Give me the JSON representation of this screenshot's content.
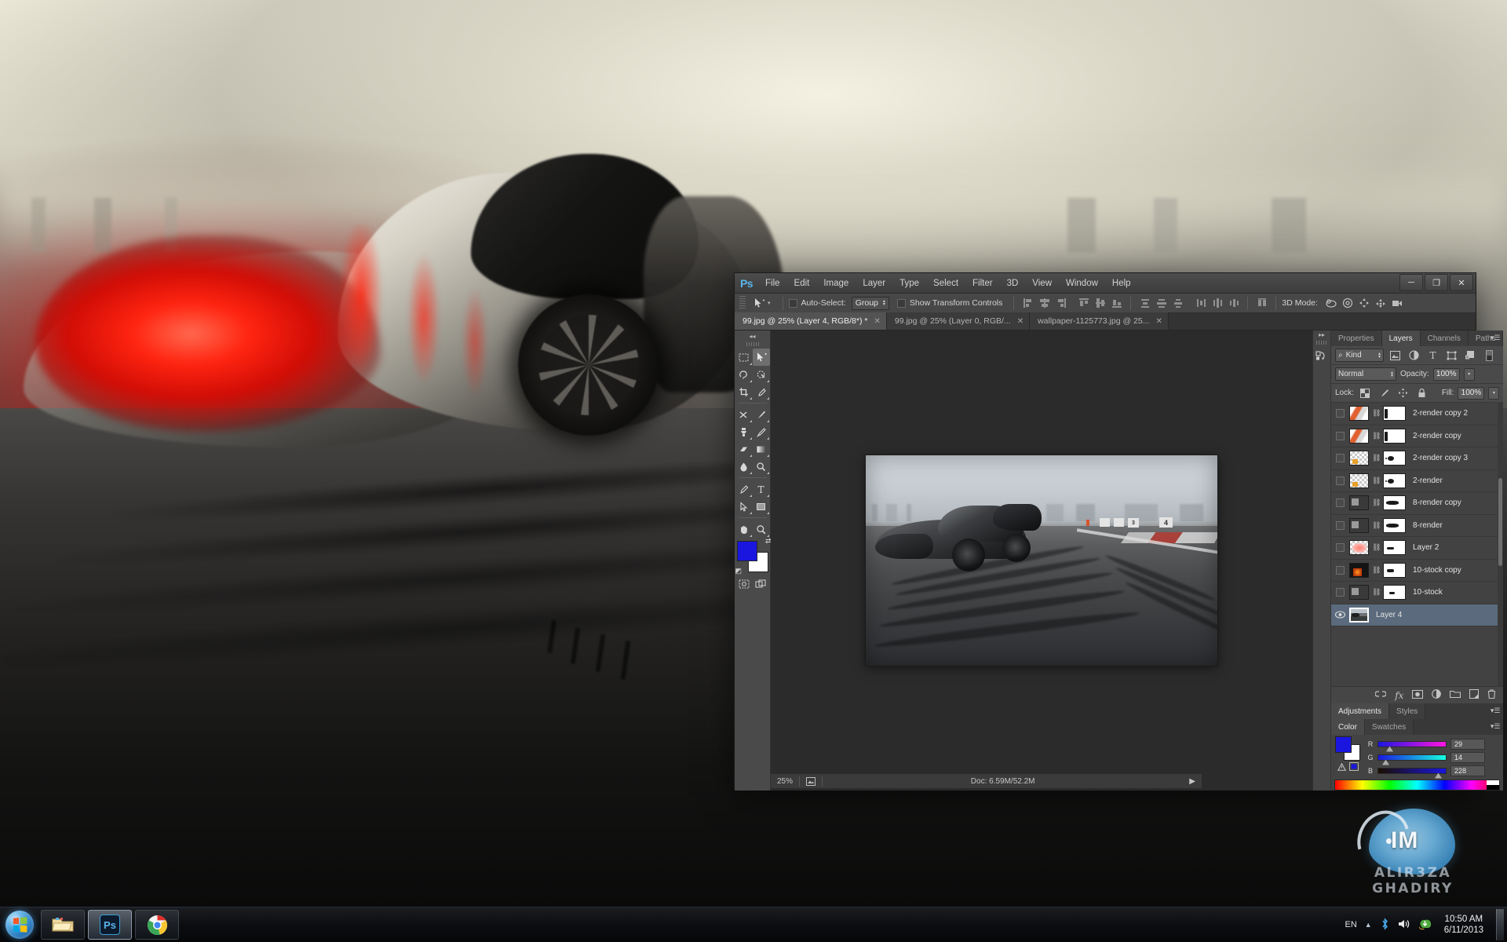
{
  "desktop": {
    "wallpaper_alt": "Dark concept supercar on racetrack with red glowing headlight",
    "watermark": {
      "brand": "IM",
      "name": "ALIR3ZA GHADIRY"
    }
  },
  "app": {
    "name": "Ps",
    "menus": [
      "File",
      "Edit",
      "Image",
      "Layer",
      "Type",
      "Select",
      "Filter",
      "3D",
      "View",
      "Window",
      "Help"
    ],
    "window_controls": {
      "minimize": "─",
      "restore": "❐",
      "close": "✕"
    }
  },
  "options_bar": {
    "tool_icon": "move-tool",
    "auto_select_label": "Auto-Select:",
    "auto_select_value": "Group",
    "show_transform_label": "Show Transform Controls",
    "mode_3d_label": "3D Mode:",
    "align_icons": [
      "align-left-edges",
      "align-horizontal-centers",
      "align-right-edges",
      "align-top-edges",
      "align-vertical-centers",
      "align-bottom-edges",
      "distribute-top-edges",
      "distribute-vertical-centers",
      "distribute-bottom-edges",
      "distribute-left-edges",
      "distribute-horizontal-centers",
      "distribute-right-edges"
    ],
    "mode_3d_icons": [
      "rotate-3d-object",
      "roll-3d-object",
      "drag-3d-object",
      "slide-3d-object",
      "scale-3d-object"
    ]
  },
  "tabs": [
    {
      "label": "99.jpg @ 25% (Layer 4, RGB/8*) *",
      "active": true,
      "close": "✕"
    },
    {
      "label": "99.jpg @ 25% (Layer 0, RGB/...",
      "active": false,
      "close": "✕"
    },
    {
      "label": "wallpaper-1125773.jpg @ 25...",
      "active": false,
      "close": "✕"
    }
  ],
  "toolbox": {
    "collapse": "◂◂",
    "tools": [
      {
        "name": "rectangular-marquee-tool",
        "glyph": "⬚",
        "selected": false
      },
      {
        "name": "move-tool",
        "glyph": "➤",
        "selected": true
      },
      {
        "name": "lasso-tool",
        "glyph": "☂",
        "selected": false
      },
      {
        "name": "quick-selection-tool",
        "glyph": "◌",
        "selected": false
      },
      {
        "name": "crop-tool",
        "glyph": "⌗",
        "selected": false
      },
      {
        "name": "eyedropper-tool",
        "glyph": "✐",
        "selected": false
      },
      {
        "name": "spot-healing-brush-tool",
        "glyph": "✂",
        "selected": false
      },
      {
        "name": "brush-tool",
        "glyph": "✎",
        "selected": false
      },
      {
        "name": "clone-stamp-tool",
        "glyph": "⚓",
        "selected": false
      },
      {
        "name": "history-brush-tool",
        "glyph": "✒",
        "selected": false
      },
      {
        "name": "eraser-tool",
        "glyph": "▱",
        "selected": false
      },
      {
        "name": "gradient-tool",
        "glyph": "■",
        "selected": false
      },
      {
        "name": "blur-tool",
        "glyph": "●",
        "selected": false
      },
      {
        "name": "dodge-tool",
        "glyph": "⚲",
        "selected": false
      },
      {
        "name": "pen-tool",
        "glyph": "✑",
        "selected": false
      },
      {
        "name": "horizontal-type-tool",
        "glyph": "T",
        "selected": false
      },
      {
        "name": "path-selection-tool",
        "glyph": "➤",
        "selected": false
      },
      {
        "name": "rectangle-tool",
        "glyph": "▭",
        "selected": false
      },
      {
        "name": "hand-tool",
        "glyph": "✋",
        "selected": false
      },
      {
        "name": "zoom-tool",
        "glyph": "⚲",
        "selected": false
      }
    ],
    "foreground_color": "#1a16e0",
    "background_color": "#ffffff",
    "extras": [
      {
        "name": "quick-mask-mode",
        "glyph": "▣"
      },
      {
        "name": "screen-mode",
        "glyph": "⧉"
      }
    ]
  },
  "canvas": {
    "zoom": "25%",
    "artwork_alt": "Black concept supercar on racetrack with tire skid marks",
    "track_blocks": [
      "3",
      "4"
    ]
  },
  "status_bar": {
    "zoom": "25%",
    "doc_info": "Doc: 6.59M/52.2M",
    "expand_arrow": "▶"
  },
  "dock_strip": {
    "collapse": "▸▸",
    "icons": [
      {
        "name": "history-panel-icon",
        "glyph": "↺"
      }
    ]
  },
  "panels": {
    "top_group": {
      "tabs": [
        {
          "label": "Properties",
          "active": false
        },
        {
          "label": "Layers",
          "active": true
        },
        {
          "label": "Channels",
          "active": false
        },
        {
          "label": "Paths",
          "active": false
        }
      ],
      "menu_icon": "panel-menu-icon"
    },
    "layers": {
      "filter_label": "Kind",
      "filter_icons": [
        {
          "name": "filter-pixel-layers-icon",
          "glyph": "⛰"
        },
        {
          "name": "filter-adjustment-layers-icon",
          "glyph": "◑"
        },
        {
          "name": "filter-type-layers-icon",
          "glyph": "T"
        },
        {
          "name": "filter-shape-layers-icon",
          "glyph": "⬚"
        },
        {
          "name": "filter-smart-objects-icon",
          "glyph": "❐"
        },
        {
          "name": "filter-toggle-icon",
          "glyph": "▮"
        }
      ],
      "blend_mode": "Normal",
      "opacity_label": "Opacity:",
      "opacity_value": "100%",
      "lock_label": "Lock:",
      "lock_icons": [
        {
          "name": "lock-transparent-pixels-icon",
          "glyph": "⬚"
        },
        {
          "name": "lock-image-pixels-icon",
          "glyph": "✎"
        },
        {
          "name": "lock-position-icon",
          "glyph": "✥"
        },
        {
          "name": "lock-all-icon",
          "glyph": "ὑ2"
        }
      ],
      "fill_label": "Fill:",
      "fill_value": "100%",
      "items": [
        {
          "name": "2-render copy 2",
          "visible": false,
          "selected": false,
          "thumb": "gradient"
        },
        {
          "name": "2-render copy",
          "visible": false,
          "selected": false,
          "thumb": "gradient"
        },
        {
          "name": "2-render copy 3",
          "visible": false,
          "selected": false,
          "thumb": "smoke"
        },
        {
          "name": "2-render",
          "visible": false,
          "selected": false,
          "thumb": "smoke"
        },
        {
          "name": "8-render copy",
          "visible": false,
          "selected": false,
          "thumb": "dark"
        },
        {
          "name": "8-render",
          "visible": false,
          "selected": false,
          "thumb": "dark"
        },
        {
          "name": "Layer 2",
          "visible": false,
          "selected": false,
          "thumb": "red"
        },
        {
          "name": "10-stock copy",
          "visible": false,
          "selected": false,
          "thumb": "fire"
        },
        {
          "name": "10-stock",
          "visible": false,
          "selected": false,
          "thumb": "dark"
        },
        {
          "name": "Layer 4",
          "visible": true,
          "selected": true,
          "thumb": "photo"
        }
      ],
      "footer_icons": [
        {
          "name": "link-layers-icon",
          "glyph": "⚭"
        },
        {
          "name": "layer-style-fx-icon",
          "glyph": "fx"
        },
        {
          "name": "add-layer-mask-icon",
          "glyph": "▣"
        },
        {
          "name": "new-adjustment-layer-icon",
          "glyph": "◑"
        },
        {
          "name": "new-group-icon",
          "glyph": "▱"
        },
        {
          "name": "new-layer-icon",
          "glyph": "❐"
        },
        {
          "name": "delete-layer-icon",
          "glyph": "Ὕ1"
        }
      ]
    },
    "adjustments_group": {
      "tabs": [
        {
          "label": "Adjustments",
          "active": true
        },
        {
          "label": "Styles",
          "active": false
        }
      ]
    },
    "color_group": {
      "tabs": [
        {
          "label": "Color",
          "active": true
        },
        {
          "label": "Swatches",
          "active": false
        }
      ],
      "foreground_color": "#1a16e0",
      "background_color": "#ffffff",
      "channels": [
        {
          "label": "R",
          "value": "29"
        },
        {
          "label": "G",
          "value": "14"
        },
        {
          "label": "B",
          "value": "228"
        }
      ],
      "warning_icon": "out-of-gamut-warning-icon"
    }
  },
  "taskbar": {
    "start_label": "Start",
    "buttons": [
      {
        "name": "taskbar-windows-explorer",
        "active": false
      },
      {
        "name": "taskbar-photoshop",
        "active": true,
        "label": "Ps"
      },
      {
        "name": "taskbar-google-chrome",
        "active": false
      }
    ],
    "tray": {
      "language": "EN",
      "show_hidden_icons": "▲",
      "icons": [
        {
          "name": "bluetooth-icon",
          "glyph": "ᛗ"
        },
        {
          "name": "volume-icon",
          "glyph": "🔊"
        },
        {
          "name": "internet-download-manager-icon",
          "glyph": "◔"
        }
      ],
      "time": "10:50 AM",
      "date": "6/11/2013"
    }
  }
}
